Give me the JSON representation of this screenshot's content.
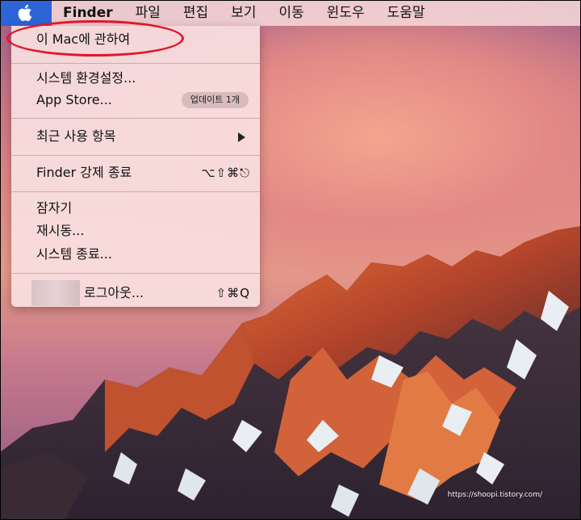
{
  "menubar": {
    "apple_icon": "apple-icon",
    "app_name": "Finder",
    "menus": [
      "파일",
      "편집",
      "보기",
      "이동",
      "윈도우",
      "도움말"
    ]
  },
  "apple_menu": {
    "about": "이 Mac에 관하여",
    "system_prefs": "시스템 환경설정...",
    "app_store": "App Store...",
    "app_store_badge": "업데이트 1개",
    "recent_items": "최근 사용 항목",
    "force_quit": "Finder 강제 종료",
    "force_quit_shortcut": "⌥⇧⌘⎋",
    "sleep": "잠자기",
    "restart": "재시동...",
    "shutdown": "시스템 종료...",
    "logout": "로그아웃...",
    "logout_shortcut": "⇧⌘Q"
  },
  "annotation": {
    "highlight_color": "#e0172a"
  },
  "watermark": "https://shoopi.tistory.com/",
  "colors": {
    "apple_tile": "#2d64d8",
    "menubar_bg": "#f5d7d7"
  }
}
